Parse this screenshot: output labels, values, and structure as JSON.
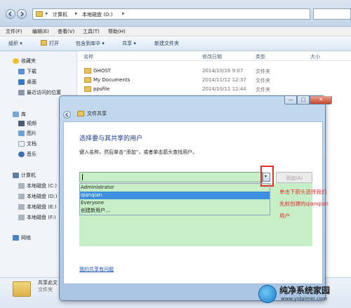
{
  "address": {
    "crumbs": [
      "计算机",
      "本地磁盘 (D:)"
    ],
    "sep": "▸"
  },
  "menubar": [
    "文件(F)",
    "编辑(E)",
    "查看(V)",
    "工具(T)",
    "帮助(H)"
  ],
  "toolbar": {
    "organize": "组织 ▾",
    "open": "打开",
    "include_library": "包含到库中 ▾",
    "share": "共享 ▾",
    "new_folder": "新建文件夹"
  },
  "nav": {
    "favorites": "收藏夹",
    "downloads": "下载",
    "desktop": "桌面",
    "recent": "最近访问的位置",
    "libraries": "库",
    "videos": "视频",
    "pictures": "图片",
    "documents": "文档",
    "music": "音乐",
    "computer": "计算机",
    "drive_c": "本地磁盘 (C:)",
    "drive_d": "本地磁盘 (D:)",
    "drive_e": "本地磁盘 (E:)",
    "drive_f": "本地磁盘 (F:)",
    "network": "网络"
  },
  "columns": {
    "name": "名称",
    "date": "修改日期",
    "type": "类型",
    "size": "大小"
  },
  "files": [
    {
      "name": "GHOST",
      "date": "2014/10/16 9:07",
      "type": "文件夹"
    },
    {
      "name": "My Documents",
      "date": "2014/11/12 12:37",
      "type": "文件夹"
    },
    {
      "name": "ppsfile",
      "date": "2014/10/11 12:44",
      "type": "文件夹"
    }
  ],
  "status": {
    "name": "共享此文",
    "type": "文件夹"
  },
  "dialog": {
    "title": "文件共享",
    "heading": "选择要与其共享的用户",
    "instruction": "键入名称，然后单击“添加”，或者单击箭头查找用户。",
    "dropdown_arrow": "▾",
    "add_button": "添加(A)",
    "options": [
      "Administrator",
      "qianqian",
      "Everyone",
      "创建新用户..."
    ],
    "selected_index": 1,
    "help_link": "我的共享有问题",
    "controls": {
      "min": "—",
      "max": "□",
      "close": "✕"
    }
  },
  "annotation": [
    "单击下箭头选择我们",
    "先前创建的qianqian",
    "用户"
  ],
  "watermark": {
    "title": "纯净系统家园",
    "url": "www.yidaimei.com"
  },
  "colors": {
    "annotation_red": "#e03030",
    "selection_blue": "#3d8fe0",
    "input_green": "#c6eec7",
    "heading_blue": "#1e3e8a"
  }
}
